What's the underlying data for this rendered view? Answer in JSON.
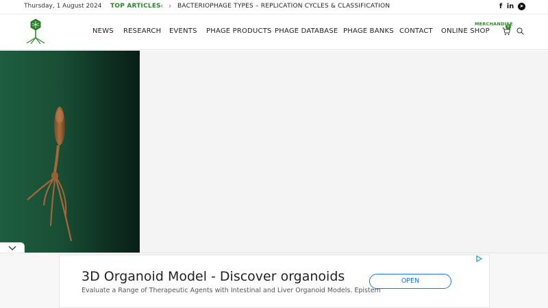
{
  "topbar": {
    "date": "Thursday, 1 August 2024",
    "top_articles_label": "TOP ARTICLES",
    "headline": "BACTERIOPHAGE TYPES – REPLICATION CYCLES & CLASSIFICATION",
    "prev_arrow": "‹",
    "next_arrow": "›",
    "social": [
      {
        "name": "facebook-icon",
        "glyph": "f"
      },
      {
        "name": "linkedin-icon",
        "glyph": "in"
      },
      {
        "name": "telegram-icon",
        "glyph": "➤"
      }
    ]
  },
  "header": {
    "nav": [
      "NEWS",
      "RESEARCH",
      "EVENTS",
      "PHAGE PRODUCTS",
      "PHAGE DATABASE",
      "PHAGE BANKS",
      "CONTACT",
      "ONLINE SHOP"
    ],
    "merch_label": "MERCHANDISE",
    "cart_count": "0"
  },
  "collapse_icon": "chevron-down-icon",
  "ad": {
    "title": "3D Organoid Model - Discover organoids",
    "description": "Evaluate a Range of Therapeutic Agents with Intestinal and Liver Organoid Models. Epistem",
    "button_label": "OPEN"
  },
  "colors": {
    "accent": "#2c8a2c",
    "ad_button": "#1a73e8",
    "hero_green": "#1f5e40"
  }
}
